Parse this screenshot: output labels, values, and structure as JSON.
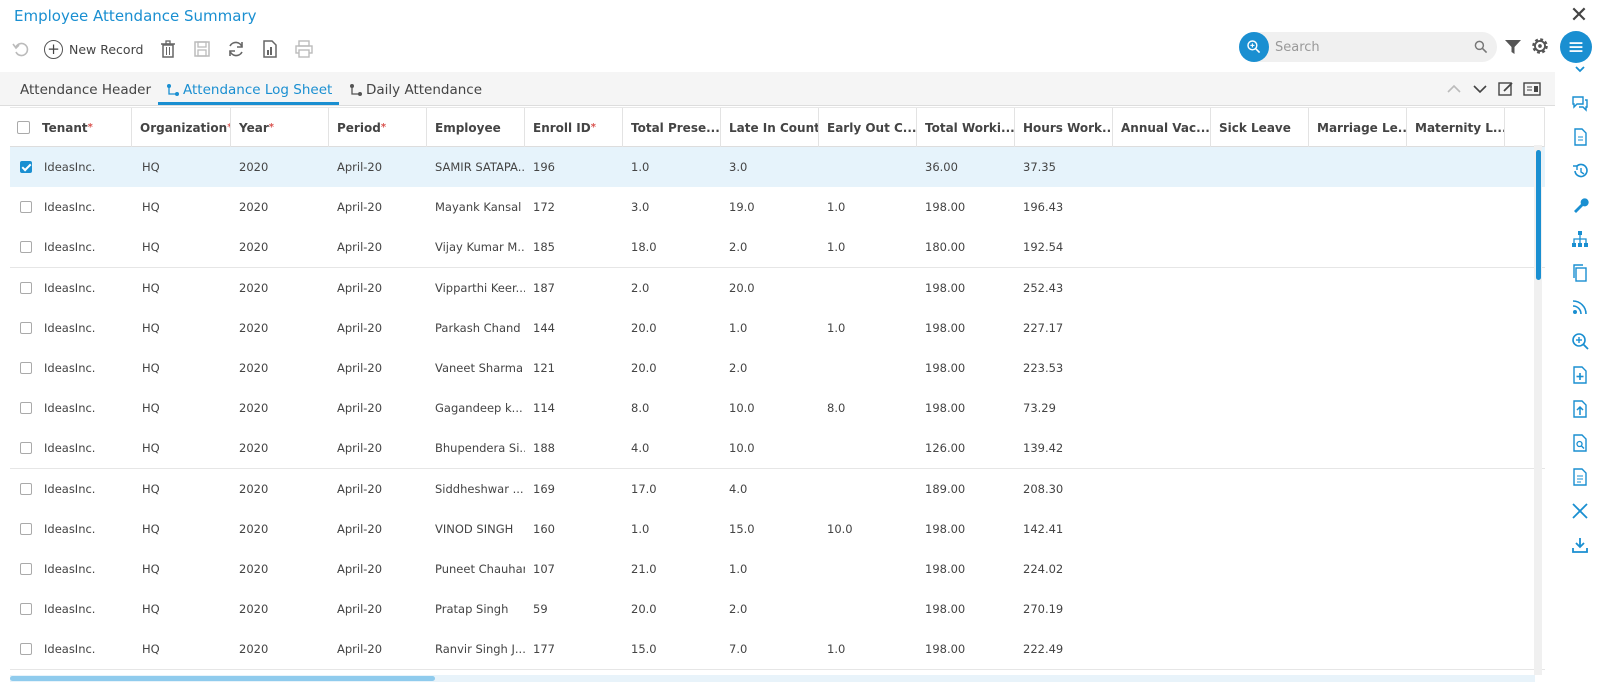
{
  "window": {
    "title": "Employee Attendance Summary"
  },
  "toolbar": {
    "new_record_label": "New Record"
  },
  "search": {
    "placeholder": "Search",
    "value": ""
  },
  "tabs": [
    {
      "label": "Attendance Header"
    },
    {
      "label": "Attendance Log Sheet"
    },
    {
      "label": "Daily Attendance"
    }
  ],
  "colors": {
    "accent": "#1a8fd1",
    "selected_row": "#e6f3fb",
    "required": "#d9534f"
  },
  "grid": {
    "columns": [
      {
        "label": "Tenant",
        "required": true
      },
      {
        "label": "Organization",
        "required": true
      },
      {
        "label": "Year",
        "required": true
      },
      {
        "label": "Period",
        "required": true
      },
      {
        "label": "Employee",
        "required": false
      },
      {
        "label": "Enroll ID",
        "required": true
      },
      {
        "label": "Total Prese...",
        "required": false
      },
      {
        "label": "Late In Count",
        "required": false
      },
      {
        "label": "Early Out C...",
        "required": false
      },
      {
        "label": "Total Worki...",
        "required": false
      },
      {
        "label": "Hours Work...",
        "required": false
      },
      {
        "label": "Annual Vac...",
        "required": false
      },
      {
        "label": "Sick Leave",
        "required": false
      },
      {
        "label": "Marriage Le...",
        "required": false
      },
      {
        "label": "Maternity L...",
        "required": false
      }
    ],
    "rows": [
      {
        "checked": true,
        "cells": [
          "IdeasInc.",
          "HQ",
          "2020",
          "April-20",
          "SAMIR SATAPA...",
          "196",
          "1.0",
          "3.0",
          "",
          "36.00",
          "37.35",
          "",
          "",
          "",
          ""
        ]
      },
      {
        "checked": false,
        "cells": [
          "IdeasInc.",
          "HQ",
          "2020",
          "April-20",
          "Mayank Kansal",
          "172",
          "3.0",
          "19.0",
          "1.0",
          "198.00",
          "196.43",
          "",
          "",
          "",
          ""
        ]
      },
      {
        "checked": false,
        "cells": [
          "IdeasInc.",
          "HQ",
          "2020",
          "April-20",
          "Vijay Kumar M...",
          "185",
          "18.0",
          "2.0",
          "1.0",
          "180.00",
          "192.54",
          "",
          "",
          "",
          ""
        ]
      },
      {
        "checked": false,
        "cells": [
          "IdeasInc.",
          "HQ",
          "2020",
          "April-20",
          "Vipparthi Keer...",
          "187",
          "2.0",
          "20.0",
          "",
          "198.00",
          "252.43",
          "",
          "",
          "",
          ""
        ]
      },
      {
        "checked": false,
        "cells": [
          "IdeasInc.",
          "HQ",
          "2020",
          "April-20",
          "Parkash Chand",
          "144",
          "20.0",
          "1.0",
          "1.0",
          "198.00",
          "227.17",
          "",
          "",
          "",
          ""
        ]
      },
      {
        "checked": false,
        "cells": [
          "IdeasInc.",
          "HQ",
          "2020",
          "April-20",
          "Vaneet Sharma",
          "121",
          "20.0",
          "2.0",
          "",
          "198.00",
          "223.53",
          "",
          "",
          "",
          ""
        ]
      },
      {
        "checked": false,
        "cells": [
          "IdeasInc.",
          "HQ",
          "2020",
          "April-20",
          "Gagandeep k...",
          "114",
          "8.0",
          "10.0",
          "8.0",
          "198.00",
          "73.29",
          "",
          "",
          "",
          ""
        ]
      },
      {
        "checked": false,
        "cells": [
          "IdeasInc.",
          "HQ",
          "2020",
          "April-20",
          "Bhupendera Si...",
          "188",
          "4.0",
          "10.0",
          "",
          "126.00",
          "139.42",
          "",
          "",
          "",
          ""
        ]
      },
      {
        "checked": false,
        "cells": [
          "IdeasInc.",
          "HQ",
          "2020",
          "April-20",
          "Siddheshwar ...",
          "169",
          "17.0",
          "4.0",
          "",
          "189.00",
          "208.30",
          "",
          "",
          "",
          ""
        ]
      },
      {
        "checked": false,
        "cells": [
          "IdeasInc.",
          "HQ",
          "2020",
          "April-20",
          "VINOD SINGH",
          "160",
          "1.0",
          "15.0",
          "10.0",
          "198.00",
          "142.41",
          "",
          "",
          "",
          ""
        ]
      },
      {
        "checked": false,
        "cells": [
          "IdeasInc.",
          "HQ",
          "2020",
          "April-20",
          "Puneet Chauhan",
          "107",
          "21.0",
          "1.0",
          "",
          "198.00",
          "224.02",
          "",
          "",
          "",
          ""
        ]
      },
      {
        "checked": false,
        "cells": [
          "IdeasInc.",
          "HQ",
          "2020",
          "April-20",
          "Pratap Singh",
          "59",
          "20.0",
          "2.0",
          "",
          "198.00",
          "270.19",
          "",
          "",
          "",
          ""
        ]
      },
      {
        "checked": false,
        "cells": [
          "IdeasInc.",
          "HQ",
          "2020",
          "April-20",
          "Ranvir Singh J...",
          "177",
          "15.0",
          "7.0",
          "1.0",
          "198.00",
          "222.49",
          "",
          "",
          "",
          ""
        ]
      }
    ]
  },
  "rail_icons": [
    "chevron-down-icon",
    "chat-icon",
    "document-icon",
    "history-icon",
    "wrench-icon",
    "hierarchy-icon",
    "copy-icon",
    "feed-icon",
    "zoom-in-icon",
    "add-file-icon",
    "upload-file-icon",
    "search-file-icon",
    "report-icon",
    "close-icon",
    "download-icon"
  ]
}
